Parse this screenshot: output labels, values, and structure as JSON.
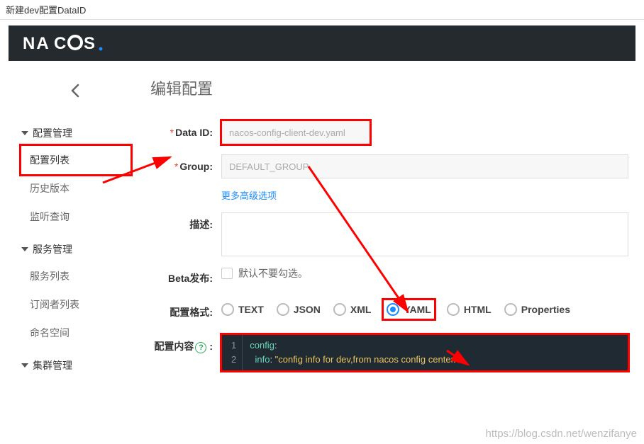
{
  "window_title": "新建dev配置DataID",
  "logo_text": "NACOS",
  "sidebar": {
    "groups": [
      {
        "label": "配置管理",
        "items": [
          "配置列表",
          "历史版本",
          "监听查询"
        ]
      },
      {
        "label": "服务管理",
        "items": [
          "服务列表",
          "订阅者列表",
          "命名空间"
        ]
      },
      {
        "label": "集群管理",
        "items": []
      }
    ]
  },
  "main": {
    "title": "编辑配置",
    "fields": {
      "data_id_label": "Data ID:",
      "data_id_value": "nacos-config-client-dev.yaml",
      "group_label": "Group:",
      "group_value": "DEFAULT_GROUP",
      "more_link": "更多高级选项",
      "desc_label": "描述:",
      "beta_label": "Beta发布:",
      "beta_hint": "默认不要勾选。",
      "format_label": "配置格式:",
      "format_options": [
        "TEXT",
        "JSON",
        "XML",
        "YAML",
        "HTML",
        "Properties"
      ],
      "format_selected": "YAML",
      "content_label": "配置内容",
      "editor_lines": [
        {
          "n": 1,
          "key": "config",
          "colon": ":",
          "str": ""
        },
        {
          "n": 2,
          "indent": "  ",
          "key": "info",
          "colon": ": ",
          "str": "\"config info for dev,from nacos config center.\""
        }
      ]
    }
  },
  "watermark": "https://blog.csdn.net/wenzifanye"
}
